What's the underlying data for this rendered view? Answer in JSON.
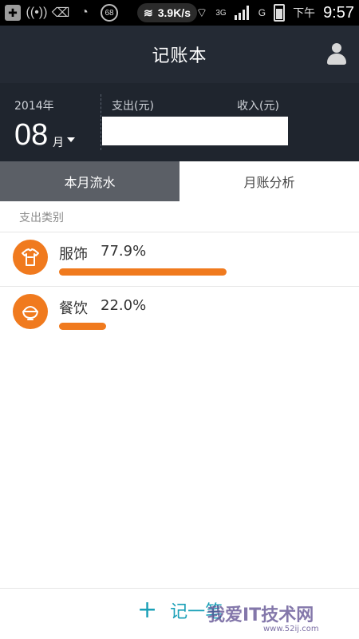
{
  "status_bar": {
    "speed": "3.9K/s",
    "notif_badge": "68",
    "ampm": "下午",
    "time": "9:57",
    "net_label": "G",
    "net_label2": "3G"
  },
  "header": {
    "title": "记账本"
  },
  "summary": {
    "year": "2014年",
    "month": "08",
    "month_suffix": "月",
    "expense_label": "支出(元)",
    "income_label": "收入(元)"
  },
  "tabs": [
    {
      "label": "本月流水",
      "active": true
    },
    {
      "label": "月账分析",
      "active": false
    }
  ],
  "section": {
    "title": "支出类别"
  },
  "categories": [
    {
      "name": "服饰",
      "percent_text": "77.9%",
      "percent": 77.9,
      "icon": "shirt-icon"
    },
    {
      "name": "餐饮",
      "percent_text": "22.0%",
      "percent": 22.0,
      "icon": "rice-bowl-icon"
    }
  ],
  "bottom": {
    "add_label": "记一笔",
    "watermark": "我爱IT技术网",
    "watermark_url": "www.52ij.com"
  },
  "colors": {
    "header_bg": "#242a34",
    "accent_orange": "#f07a1e",
    "accent_teal": "#1aa0b7"
  }
}
